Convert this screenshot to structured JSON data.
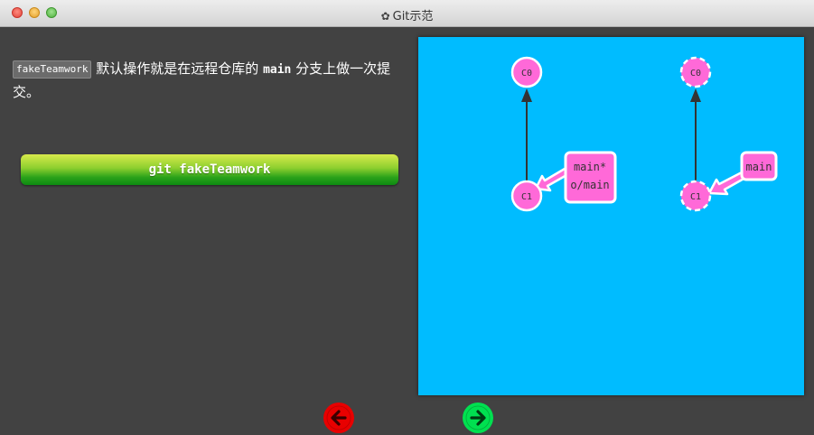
{
  "window": {
    "title": "Git示范"
  },
  "description": {
    "code_term": "fakeTeamwork",
    "text_part1": "默认操作就是在远程仓库的",
    "branch_term": "main",
    "text_part2": "分支上做一次提交。"
  },
  "command_button": {
    "label": "git fakeTeamwork"
  },
  "graph": {
    "local": {
      "commits": [
        "C0",
        "C1"
      ],
      "branch_label_line1": "main*",
      "branch_label_line2": "o/main"
    },
    "remote": {
      "commits": [
        "C0",
        "C1"
      ],
      "branch_label": "main"
    }
  },
  "colors": {
    "canvas": "#00bcff",
    "commit_fill": "#ff69d8",
    "prev_button": "#e80000",
    "next_button": "#00e050"
  },
  "icons": {
    "title_icon": "gear-icon",
    "prev": "arrow-left-icon",
    "next": "arrow-right-icon"
  }
}
